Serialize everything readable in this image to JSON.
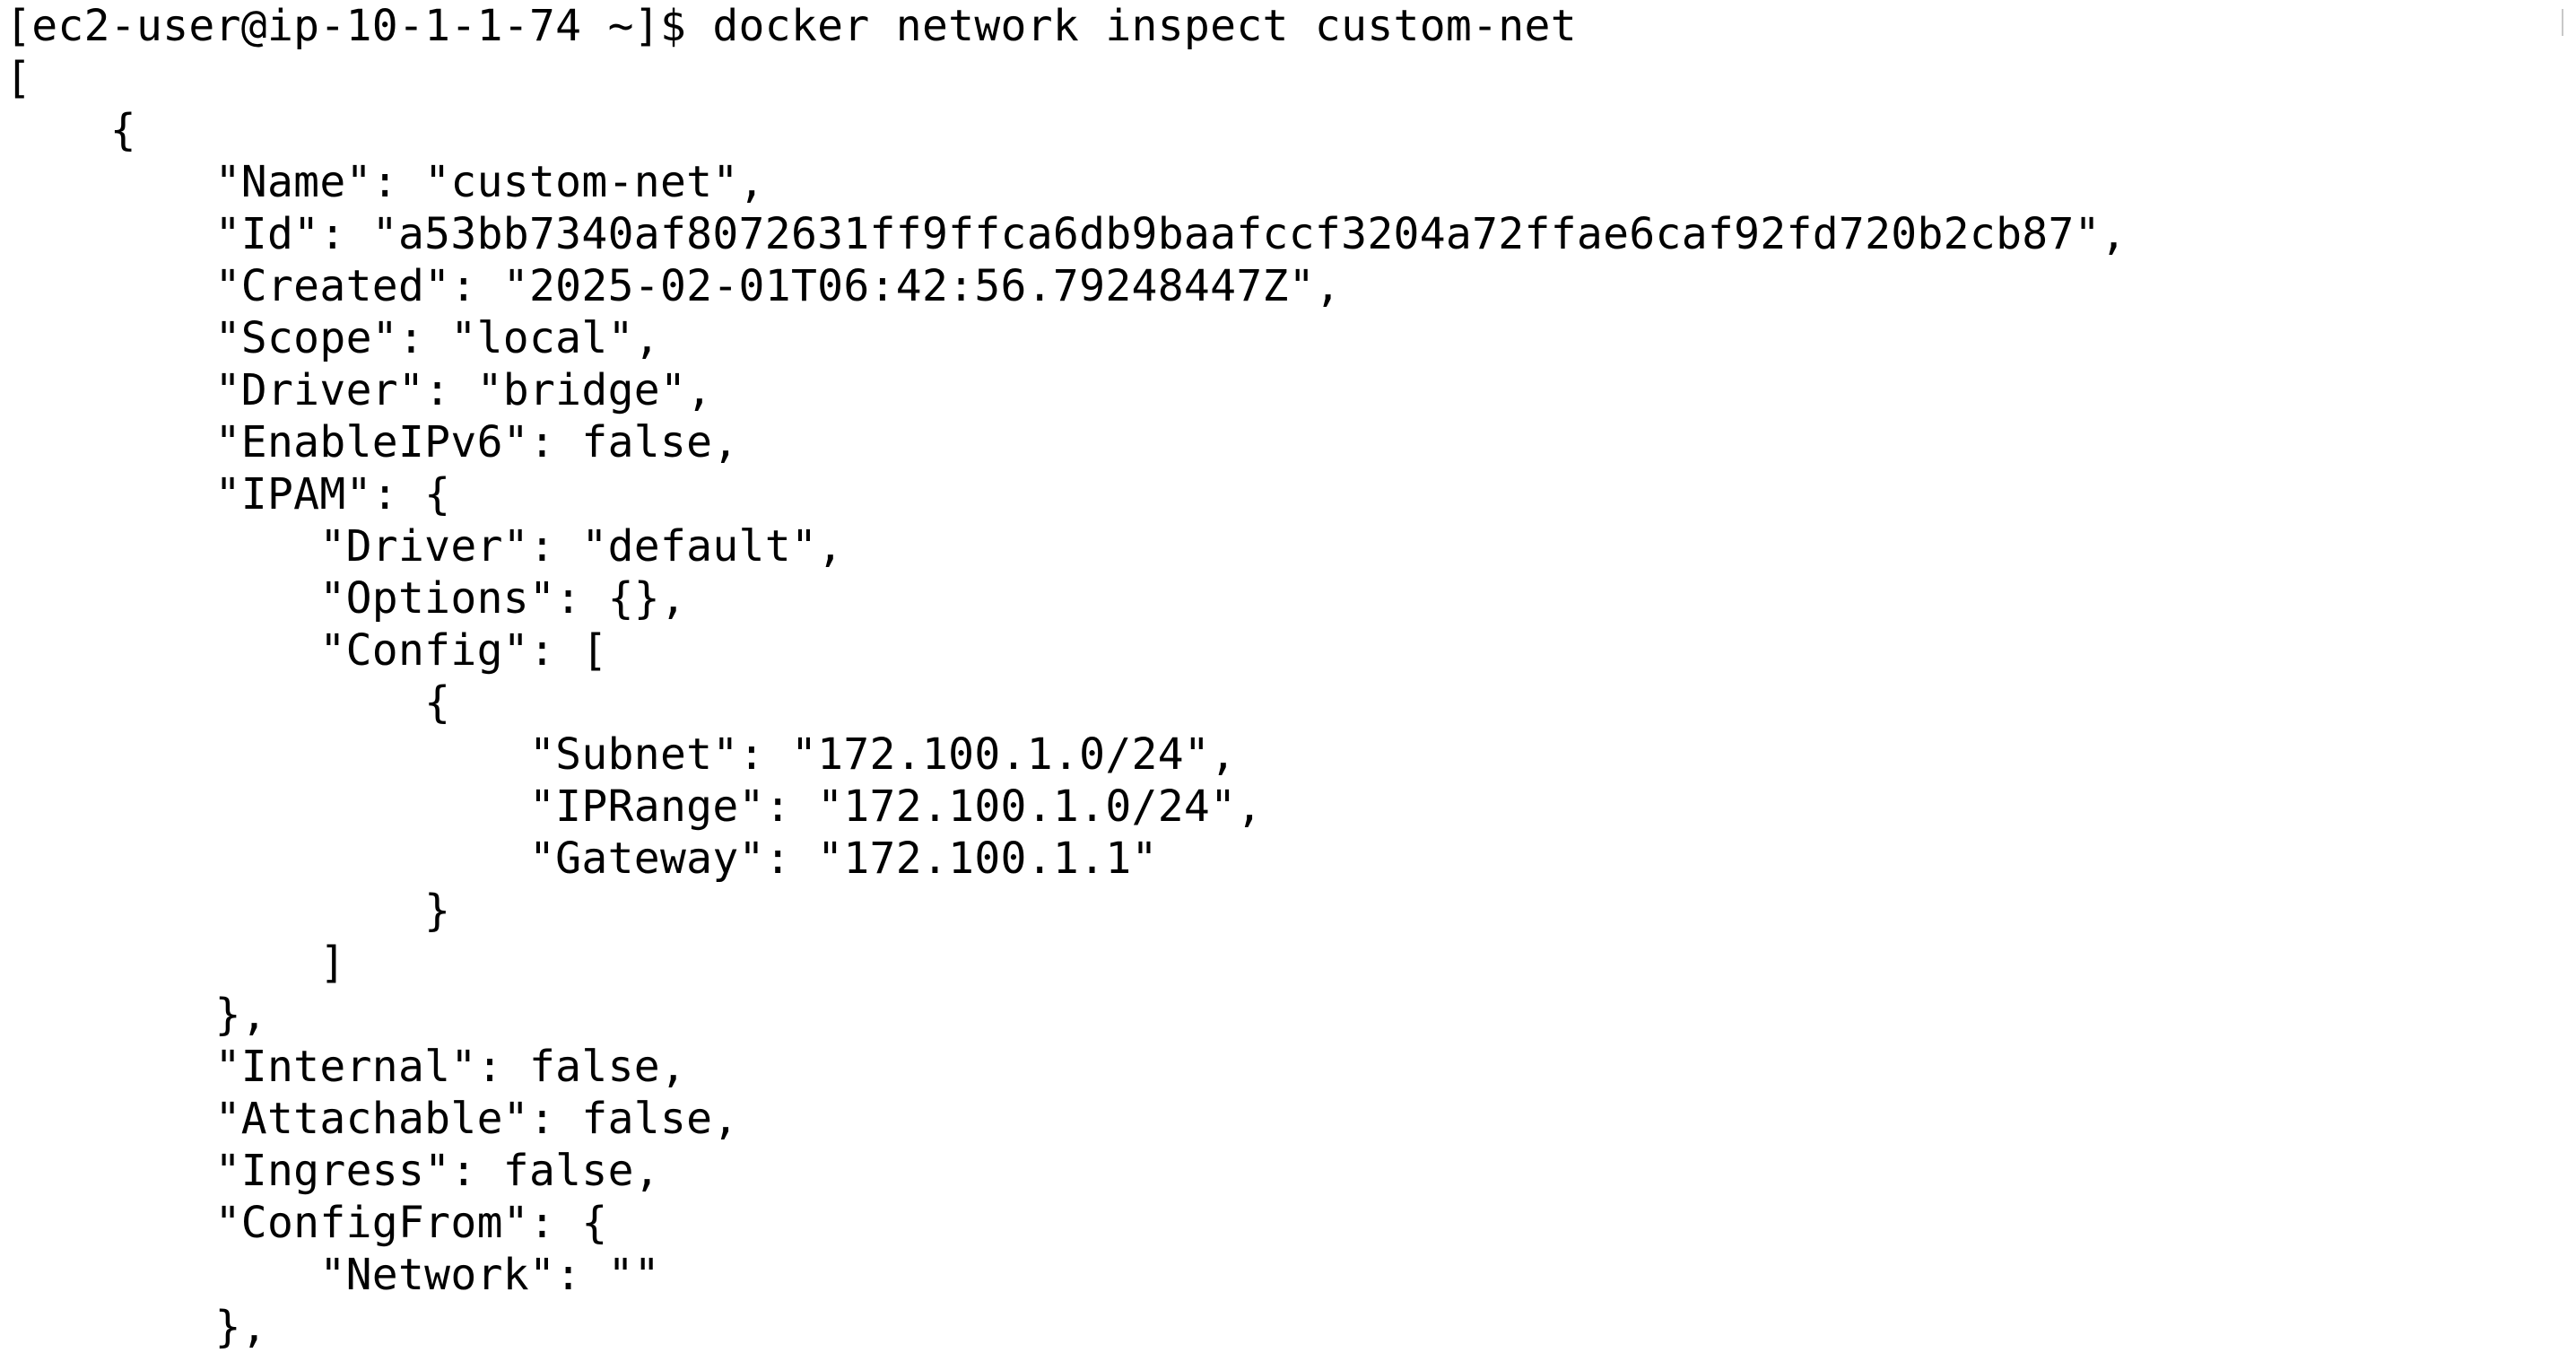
{
  "terminal": {
    "lines": [
      "[ec2-user@ip-10-1-1-74 ~]$ docker network inspect custom-net",
      "[",
      "    {",
      "        \"Name\": \"custom-net\",",
      "        \"Id\": \"a53bb7340af8072631ff9ffca6db9baafccf3204a72ffae6caf92fd720b2cb87\",",
      "        \"Created\": \"2025-02-01T06:42:56.79248447Z\",",
      "        \"Scope\": \"local\",",
      "        \"Driver\": \"bridge\",",
      "        \"EnableIPv6\": false,",
      "        \"IPAM\": {",
      "            \"Driver\": \"default\",",
      "            \"Options\": {},",
      "            \"Config\": [",
      "                {",
      "                    \"Subnet\": \"172.100.1.0/24\",",
      "                    \"IPRange\": \"172.100.1.0/24\",",
      "                    \"Gateway\": \"172.100.1.1\"",
      "                }",
      "            ]",
      "        },",
      "        \"Internal\": false,",
      "        \"Attachable\": false,",
      "        \"Ingress\": false,",
      "        \"ConfigFrom\": {",
      "            \"Network\": \"\"",
      "        },"
    ]
  }
}
